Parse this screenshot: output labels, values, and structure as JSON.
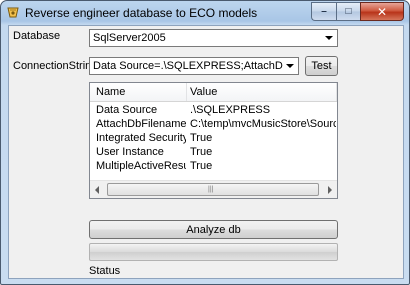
{
  "window": {
    "title": "Reverse engineer database to ECO models",
    "minimize_glyph": "–",
    "maximize_glyph": "□",
    "close_glyph": "✕"
  },
  "form": {
    "database_label": "Database",
    "database_value": "SqlServer2005",
    "connection_label": "ConnectionString",
    "connection_value": "Data Source=.\\SQLEXPRESS;AttachDbFilenam",
    "test_button": "Test"
  },
  "grid": {
    "headers": [
      "Name",
      "Value"
    ],
    "rows": [
      [
        "Data Source",
        ".\\SQLEXPRESS"
      ],
      [
        "AttachDbFilename",
        "C:\\temp\\mvcMusicStore\\Source\\..."
      ],
      [
        "Integrated Security",
        "True"
      ],
      [
        "User Instance",
        "True"
      ],
      [
        "MultipleActiveResult...",
        "True"
      ]
    ],
    "scroll_grip": "|||"
  },
  "actions": {
    "analyze_button": "Analyze db",
    "status_label": "Status",
    "progress": 0
  }
}
